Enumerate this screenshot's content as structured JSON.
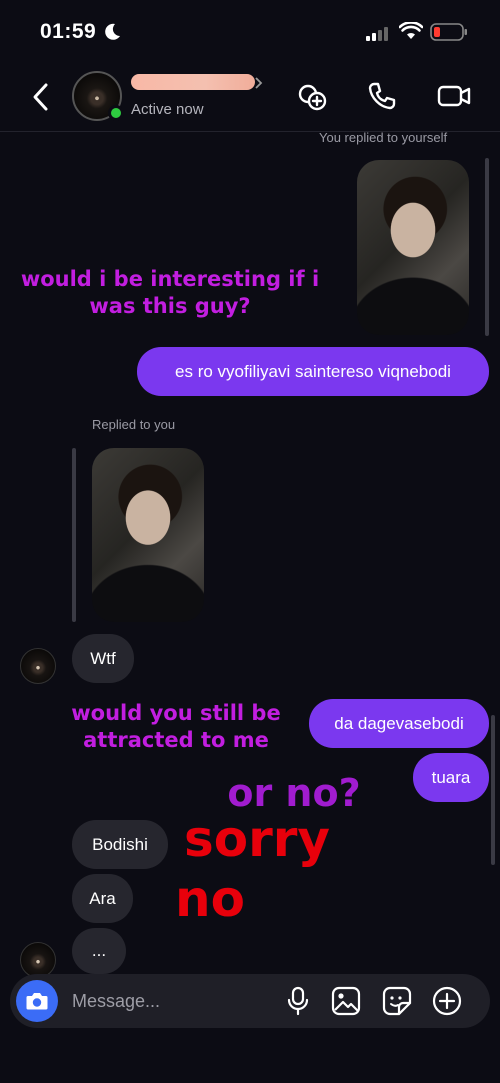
{
  "status_bar": {
    "time": "01:59",
    "focus": "moon-icon",
    "battery": "low"
  },
  "header": {
    "active_status": "Active now",
    "icons": [
      "back-chevron-icon",
      "add-people-icon",
      "phone-icon",
      "video-camera-icon"
    ]
  },
  "messages": {
    "outgoing_context": "You replied to yourself",
    "outgoing_text": "es ro vyofiliyavi saintereso viqnebodi",
    "incoming_context": "Replied to you",
    "incoming_reply": "Wtf",
    "outgoing_2": "da dagevasebodi",
    "outgoing_3": "tuara",
    "incoming_2": "Bodishi",
    "incoming_3": "Ara",
    "typing": "..."
  },
  "overlay": {
    "caption_1": "would i be interesting if i was this guy?",
    "caption_2": "would you still be attracted to me",
    "caption_3": "or no?",
    "caption_4": "sorry",
    "caption_5": "no"
  },
  "composer": {
    "placeholder": "Message...",
    "icons": [
      "camera-icon",
      "microphone-icon",
      "gallery-icon",
      "sticker-icon",
      "add-icon"
    ]
  },
  "colors": {
    "outgoing_bubble": "#7b38ef",
    "incoming_bubble": "#26262e",
    "accent_blue": "#3b6cf6",
    "online": "#2ecc40",
    "caption_purple": "#c21ee0",
    "caption_red": "#e8000b"
  }
}
